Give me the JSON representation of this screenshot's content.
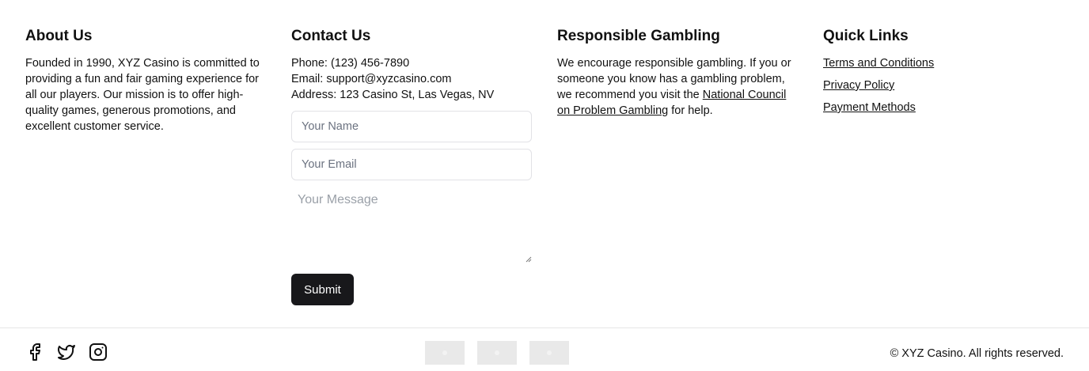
{
  "about": {
    "title": "About Us",
    "text": "Founded in 1990, XYZ Casino is committed to providing a fun and fair gaming experience for all our players. Our mission is to offer high-quality games, generous promotions, and excellent customer service."
  },
  "contact": {
    "title": "Contact Us",
    "phone": "Phone: (123) 456-7890",
    "email": "Email: support@xyzcasino.com",
    "address": "Address: 123 Casino St, Las Vegas, NV",
    "name_placeholder": "Your Name",
    "email_placeholder": "Your Email",
    "message_placeholder": "Your Message",
    "submit_label": "Submit"
  },
  "responsible": {
    "title": "Responsible Gambling",
    "text_before": "We encourage responsible gambling. If you or someone you know has a gambling problem, we recommend you visit the ",
    "link": "National Council on Problem Gambling",
    "text_after": " for help."
  },
  "quick_links": {
    "title": "Quick Links",
    "items": [
      "Terms and Conditions",
      "Privacy Policy",
      "Payment Methods"
    ]
  },
  "bottom": {
    "socials": [
      "facebook-icon",
      "twitter-icon",
      "instagram-icon"
    ],
    "payment_icons": [
      "payment-icon",
      "payment-icon",
      "payment-icon"
    ],
    "copyright": "© XYZ Casino. All rights reserved."
  }
}
